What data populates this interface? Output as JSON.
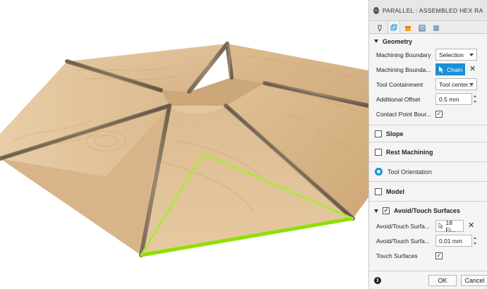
{
  "dialog": {
    "title": "PARALLEL : ASSEMBLED HEX RAMP FINIS",
    "tabs": [
      "tool-tab",
      "geometry-tab",
      "heights-tab",
      "passes-tab",
      "linking-tab"
    ],
    "geometry_header": "Geometry",
    "machining_boundary_label": "Machining Boundary",
    "machining_boundary_value": "Selection",
    "machining_boundary_sel_label": "Machining Bounda...",
    "chain_label": "Chain",
    "clear_symbol": "✕",
    "tool_containment_label": "Tool Containment",
    "tool_containment_value": "Tool center...",
    "additional_offset_label": "Additional Offset",
    "additional_offset_value": "0.5 mm",
    "contact_point_label": "Contact Point Bour...",
    "contact_point_checked": "✓",
    "slope_label": "Slope",
    "rest_machining_label": "Rest Machining",
    "tool_orientation_label": "Tool Orientation",
    "model_label": "Model",
    "avoid_header": "Avoid/Touch Surfaces",
    "avoid_header_checked": "✓",
    "avoid_surfaces_label": "Avoid/Touch Surfa...",
    "avoid_surfaces_value": "18 Fi...",
    "avoid_offset_label": "Avoid/Touch Surfa...",
    "avoid_offset_value": "0.01 mm",
    "touch_surfaces_label": "Touch Surfaces",
    "touch_surfaces_checked": "✓",
    "info_symbol": "i",
    "ok_label": "OK",
    "cancel_label": "Cancel"
  },
  "colors": {
    "accent": "#1a8fd6",
    "selection_highlight": "#8ee000",
    "wood_light": "#e2c49a",
    "wood_mid": "#d3ad7e"
  }
}
